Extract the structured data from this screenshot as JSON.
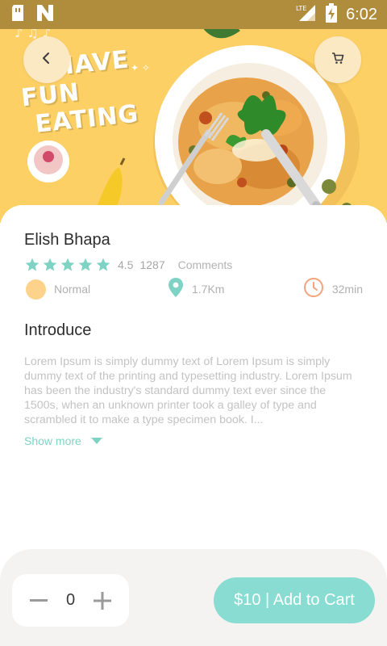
{
  "status_bar": {
    "time": "6:02",
    "network_label": "LTE"
  },
  "hero": {
    "image_text_lines": [
      "HAVE",
      "FUN",
      "EATING"
    ],
    "background_color": "#fdd066"
  },
  "nav": {
    "back_icon": "chevron-left-icon",
    "cart_icon": "shopping-cart-icon"
  },
  "dish": {
    "name": "Elish Bhapa",
    "stars": 5,
    "rating": "4.5",
    "review_count": "1287",
    "comments_label": "Comments",
    "difficulty": "Normal",
    "distance": "1.7Km",
    "time": "32min"
  },
  "introduce": {
    "heading": "Introduce",
    "body": "Lorem Ipsum is simply dummy text of Lorem Ipsum is simply dummy text of the printing and typesetting industry. Lorem Ipsum has been the industry's standard dummy text ever since the 1500s, when an unknown printer took a galley of type and scrambled it to make a type specimen book. I...",
    "show_more_label": "Show more"
  },
  "order": {
    "quantity": "0",
    "add_to_cart_label": "$10 | Add to Cart"
  },
  "colors": {
    "accent": "#88dcd1",
    "star": "#7fd3c5",
    "difficulty_dot": "#fdd38b",
    "time_icon": "#f6a27c"
  }
}
